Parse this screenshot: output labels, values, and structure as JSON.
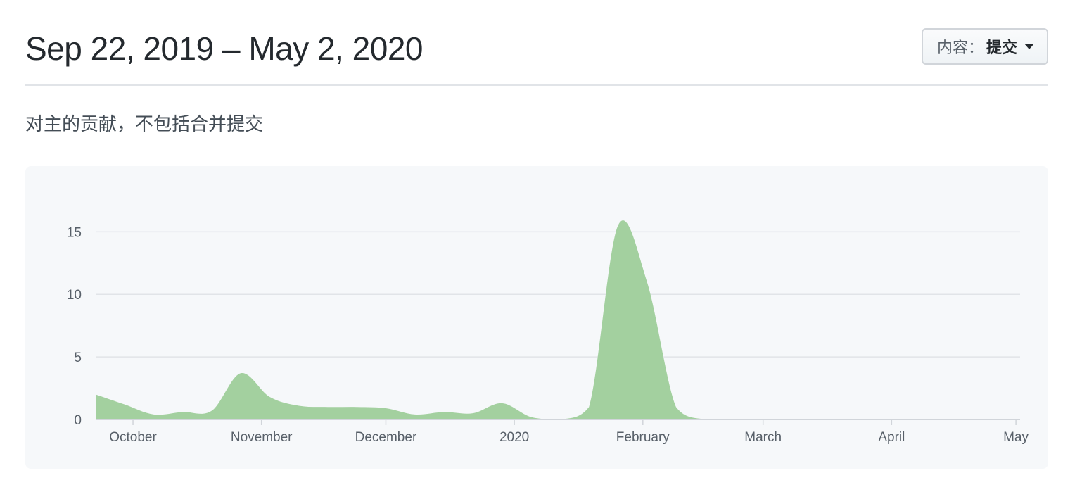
{
  "header": {
    "date_range": "Sep 22, 2019 – May 2, 2020",
    "dropdown_label": "内容：",
    "dropdown_value": "提交"
  },
  "subtitle": "对主的贡献，不包括合并提交",
  "colors": {
    "area_fill": "#a3d09f",
    "grid": "#e1e4e8",
    "axis": "#d1d5da"
  },
  "chart_data": {
    "type": "area",
    "title": "",
    "xlabel": "",
    "ylabel": "",
    "x_range": [
      "2019-09-22",
      "2020-05-02"
    ],
    "ylim": [
      0,
      18
    ],
    "y_ticks": [
      0,
      5,
      10,
      15
    ],
    "grid": true,
    "x_ticks": [
      {
        "label": "October",
        "date": "2019-10-01"
      },
      {
        "label": "November",
        "date": "2019-11-01"
      },
      {
        "label": "December",
        "date": "2019-12-01"
      },
      {
        "label": "2020",
        "date": "2020-01-01"
      },
      {
        "label": "February",
        "date": "2020-02-01"
      },
      {
        "label": "March",
        "date": "2020-03-01"
      },
      {
        "label": "April",
        "date": "2020-04-01"
      },
      {
        "label": "May",
        "date": "2020-05-01"
      }
    ],
    "series": [
      {
        "points": [
          [
            "2019-09-22",
            2.0
          ],
          [
            "2019-09-29",
            1.2
          ],
          [
            "2019-10-06",
            0.4
          ],
          [
            "2019-10-13",
            0.6
          ],
          [
            "2019-10-20",
            0.7
          ],
          [
            "2019-10-27",
            3.7
          ],
          [
            "2019-11-03",
            1.8
          ],
          [
            "2019-11-10",
            1.1
          ],
          [
            "2019-11-17",
            1.0
          ],
          [
            "2019-11-24",
            1.0
          ],
          [
            "2019-12-01",
            0.9
          ],
          [
            "2019-12-08",
            0.4
          ],
          [
            "2019-12-15",
            0.6
          ],
          [
            "2019-12-22",
            0.5
          ],
          [
            "2019-12-29",
            1.3
          ],
          [
            "2020-01-05",
            0.2
          ],
          [
            "2020-01-12",
            0.0
          ],
          [
            "2020-01-19",
            1.0
          ],
          [
            "2020-01-26",
            15.5
          ],
          [
            "2020-02-02",
            11.0
          ],
          [
            "2020-02-09",
            1.0
          ],
          [
            "2020-02-16",
            0.0
          ],
          [
            "2020-02-23",
            0.0
          ],
          [
            "2020-03-01",
            0.0
          ],
          [
            "2020-03-08",
            0.0
          ],
          [
            "2020-03-15",
            0.0
          ],
          [
            "2020-03-22",
            0.0
          ],
          [
            "2020-03-29",
            0.0
          ],
          [
            "2020-04-05",
            0.0
          ],
          [
            "2020-04-12",
            0.0
          ],
          [
            "2020-04-19",
            0.0
          ],
          [
            "2020-04-26",
            0.0
          ],
          [
            "2020-05-02",
            0.0
          ]
        ]
      }
    ]
  }
}
